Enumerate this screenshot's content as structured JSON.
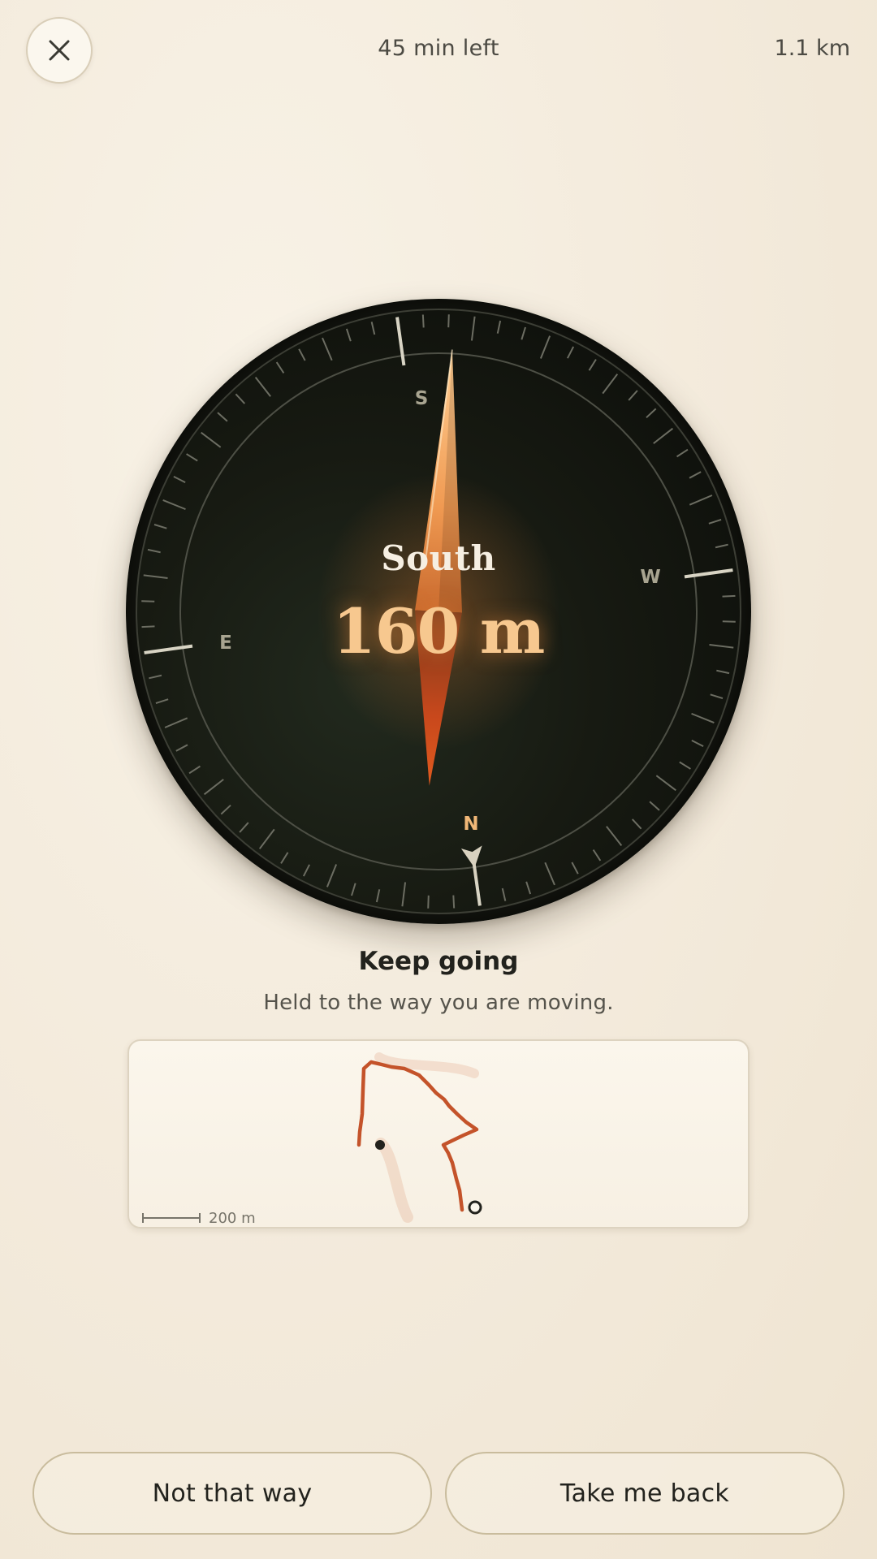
{
  "header": {
    "close_icon": "close-icon",
    "time_left": "45 min left",
    "distance_total": "1.1 km"
  },
  "compass": {
    "direction": "South",
    "distance": "160 m",
    "cardinals": {
      "n": "N",
      "e": "E",
      "s": "S",
      "w": "W"
    },
    "accent_color": "#f0a05a"
  },
  "status": {
    "title": "Keep going",
    "subtitle": "Held to the way you are moving."
  },
  "map": {
    "scale_label": "200 m",
    "route_color": "#c4532a"
  },
  "actions": {
    "left_label": "Not that way",
    "right_label": "Take me back"
  }
}
